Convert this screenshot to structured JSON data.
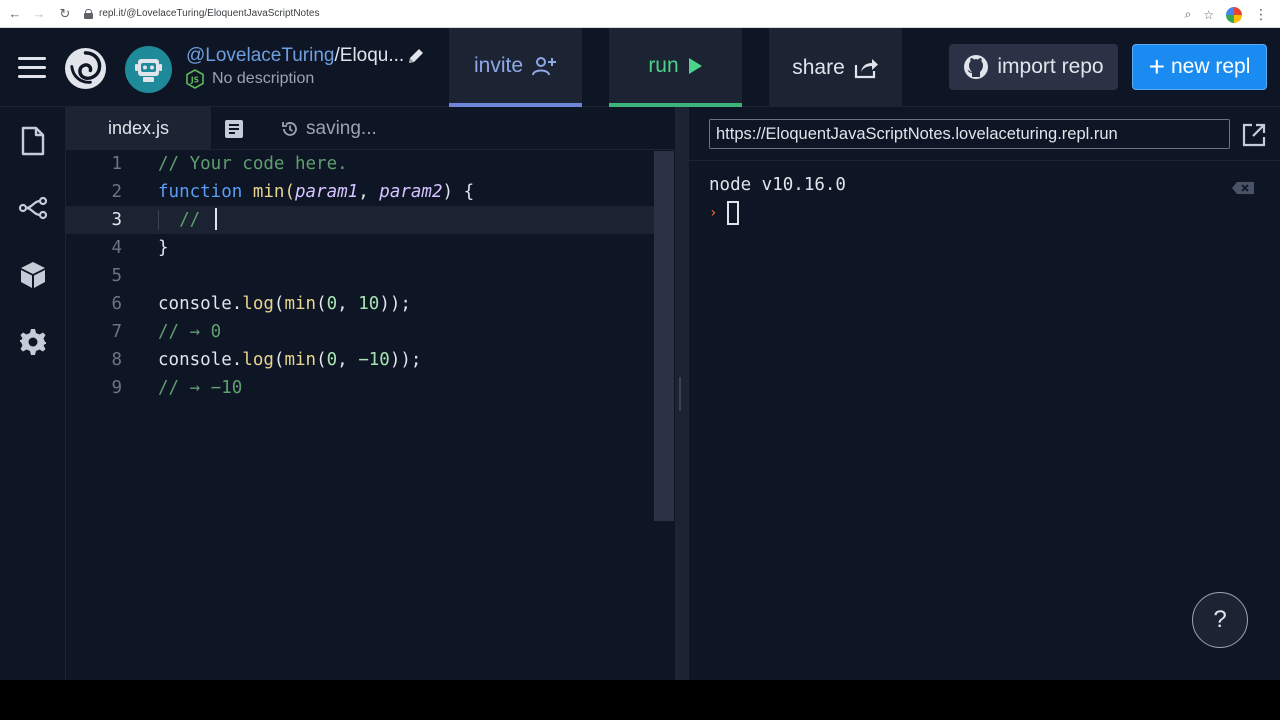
{
  "browser": {
    "url": "repl.it/@LovelaceTuring/EloquentJavaScriptNotes",
    "icons": [
      "back-icon",
      "forward-icon",
      "reload-icon",
      "lock-icon",
      "zoom-icon",
      "star-icon",
      "profile-icon",
      "menu-icon"
    ]
  },
  "header": {
    "username": "@LovelaceTuring",
    "separator": "/",
    "project_short": "Eloqu...",
    "description": "No description",
    "buttons": {
      "invite": "invite",
      "run": "run",
      "share": "share",
      "import_repo": "import repo",
      "new_repl": "new repl",
      "new_repl_plus": "+"
    }
  },
  "sidebar": {
    "items": [
      {
        "icon": "files-icon"
      },
      {
        "icon": "version-control-icon"
      },
      {
        "icon": "packages-icon"
      },
      {
        "icon": "settings-icon"
      }
    ]
  },
  "editor": {
    "tab": "index.js",
    "status": "saving...",
    "active_line": 3,
    "lines": [
      {
        "n": "1",
        "text": "// Your code here."
      },
      {
        "n": "2",
        "kw": "function",
        "fn": " min(",
        "p1": "param1",
        "sep": ", ",
        "p2": "param2",
        "end": ") {"
      },
      {
        "n": "3",
        "text": "  // "
      },
      {
        "n": "4",
        "text": "}"
      },
      {
        "n": "5",
        "text": ""
      },
      {
        "n": "6",
        "a": "console.",
        "b": "log",
        "c": "(",
        "d": "min",
        "e": "(",
        "f": "0",
        "g": ", ",
        "h": "10",
        "i": "));"
      },
      {
        "n": "7",
        "text": "// → 0"
      },
      {
        "n": "8",
        "a": "console.",
        "b": "log",
        "c": "(",
        "d": "min",
        "e": "(",
        "f": "0",
        "g": ", ",
        "h": "−10",
        "i": "));"
      },
      {
        "n": "9",
        "text": "// → −10"
      }
    ]
  },
  "console": {
    "url": "https://EloquentJavaScriptNotes.lovelaceturing.repl.run",
    "output": "node v10.16.0",
    "prompt": "›"
  },
  "help": {
    "label": "?"
  },
  "colors": {
    "bg": "#0e1525",
    "panel": "#1c2333",
    "accent_blue": "#1a8cf1",
    "run_green": "#4bd389",
    "invite_blue": "#8ea8e8"
  }
}
